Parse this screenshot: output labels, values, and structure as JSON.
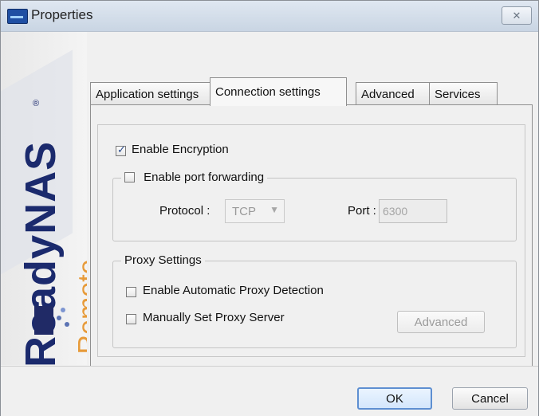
{
  "window": {
    "title": "Properties",
    "close_label": "✕"
  },
  "branding": {
    "logo_main": "ReadyNAS",
    "logo_sub": "Remote",
    "registered": "®"
  },
  "tabs": [
    {
      "label": "Application settings"
    },
    {
      "label": "Connection settings"
    },
    {
      "label": "Advanced"
    },
    {
      "label": "Services"
    }
  ],
  "connection": {
    "encryption_label": "Enable Encryption",
    "encryption_checked": true,
    "port_forwarding_label": "Enable port forwarding",
    "port_forwarding_checked": false,
    "protocol_label": "Protocol :",
    "protocol_value": "TCP",
    "port_label": "Port :",
    "port_value": "6300",
    "proxy_group_title": "Proxy Settings",
    "auto_proxy_label": "Enable Automatic Proxy Detection",
    "auto_proxy_checked": false,
    "manual_proxy_label": "Manually Set Proxy Server",
    "manual_proxy_checked": false,
    "advanced_button_label": "Advanced"
  },
  "footer": {
    "ok_label": "OK",
    "cancel_label": "Cancel"
  }
}
